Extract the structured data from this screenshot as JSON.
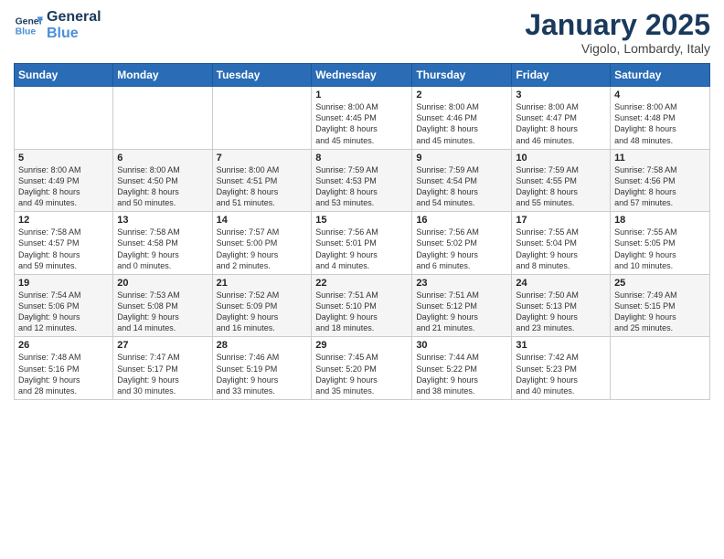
{
  "logo": {
    "line1": "General",
    "line2": "Blue"
  },
  "title": "January 2025",
  "location": "Vigolo, Lombardy, Italy",
  "days_header": [
    "Sunday",
    "Monday",
    "Tuesday",
    "Wednesday",
    "Thursday",
    "Friday",
    "Saturday"
  ],
  "weeks": [
    [
      {
        "num": "",
        "info": ""
      },
      {
        "num": "",
        "info": ""
      },
      {
        "num": "",
        "info": ""
      },
      {
        "num": "1",
        "info": "Sunrise: 8:00 AM\nSunset: 4:45 PM\nDaylight: 8 hours\nand 45 minutes."
      },
      {
        "num": "2",
        "info": "Sunrise: 8:00 AM\nSunset: 4:46 PM\nDaylight: 8 hours\nand 45 minutes."
      },
      {
        "num": "3",
        "info": "Sunrise: 8:00 AM\nSunset: 4:47 PM\nDaylight: 8 hours\nand 46 minutes."
      },
      {
        "num": "4",
        "info": "Sunrise: 8:00 AM\nSunset: 4:48 PM\nDaylight: 8 hours\nand 48 minutes."
      }
    ],
    [
      {
        "num": "5",
        "info": "Sunrise: 8:00 AM\nSunset: 4:49 PM\nDaylight: 8 hours\nand 49 minutes."
      },
      {
        "num": "6",
        "info": "Sunrise: 8:00 AM\nSunset: 4:50 PM\nDaylight: 8 hours\nand 50 minutes."
      },
      {
        "num": "7",
        "info": "Sunrise: 8:00 AM\nSunset: 4:51 PM\nDaylight: 8 hours\nand 51 minutes."
      },
      {
        "num": "8",
        "info": "Sunrise: 7:59 AM\nSunset: 4:53 PM\nDaylight: 8 hours\nand 53 minutes."
      },
      {
        "num": "9",
        "info": "Sunrise: 7:59 AM\nSunset: 4:54 PM\nDaylight: 8 hours\nand 54 minutes."
      },
      {
        "num": "10",
        "info": "Sunrise: 7:59 AM\nSunset: 4:55 PM\nDaylight: 8 hours\nand 55 minutes."
      },
      {
        "num": "11",
        "info": "Sunrise: 7:58 AM\nSunset: 4:56 PM\nDaylight: 8 hours\nand 57 minutes."
      }
    ],
    [
      {
        "num": "12",
        "info": "Sunrise: 7:58 AM\nSunset: 4:57 PM\nDaylight: 8 hours\nand 59 minutes."
      },
      {
        "num": "13",
        "info": "Sunrise: 7:58 AM\nSunset: 4:58 PM\nDaylight: 9 hours\nand 0 minutes."
      },
      {
        "num": "14",
        "info": "Sunrise: 7:57 AM\nSunset: 5:00 PM\nDaylight: 9 hours\nand 2 minutes."
      },
      {
        "num": "15",
        "info": "Sunrise: 7:56 AM\nSunset: 5:01 PM\nDaylight: 9 hours\nand 4 minutes."
      },
      {
        "num": "16",
        "info": "Sunrise: 7:56 AM\nSunset: 5:02 PM\nDaylight: 9 hours\nand 6 minutes."
      },
      {
        "num": "17",
        "info": "Sunrise: 7:55 AM\nSunset: 5:04 PM\nDaylight: 9 hours\nand 8 minutes."
      },
      {
        "num": "18",
        "info": "Sunrise: 7:55 AM\nSunset: 5:05 PM\nDaylight: 9 hours\nand 10 minutes."
      }
    ],
    [
      {
        "num": "19",
        "info": "Sunrise: 7:54 AM\nSunset: 5:06 PM\nDaylight: 9 hours\nand 12 minutes."
      },
      {
        "num": "20",
        "info": "Sunrise: 7:53 AM\nSunset: 5:08 PM\nDaylight: 9 hours\nand 14 minutes."
      },
      {
        "num": "21",
        "info": "Sunrise: 7:52 AM\nSunset: 5:09 PM\nDaylight: 9 hours\nand 16 minutes."
      },
      {
        "num": "22",
        "info": "Sunrise: 7:51 AM\nSunset: 5:10 PM\nDaylight: 9 hours\nand 18 minutes."
      },
      {
        "num": "23",
        "info": "Sunrise: 7:51 AM\nSunset: 5:12 PM\nDaylight: 9 hours\nand 21 minutes."
      },
      {
        "num": "24",
        "info": "Sunrise: 7:50 AM\nSunset: 5:13 PM\nDaylight: 9 hours\nand 23 minutes."
      },
      {
        "num": "25",
        "info": "Sunrise: 7:49 AM\nSunset: 5:15 PM\nDaylight: 9 hours\nand 25 minutes."
      }
    ],
    [
      {
        "num": "26",
        "info": "Sunrise: 7:48 AM\nSunset: 5:16 PM\nDaylight: 9 hours\nand 28 minutes."
      },
      {
        "num": "27",
        "info": "Sunrise: 7:47 AM\nSunset: 5:17 PM\nDaylight: 9 hours\nand 30 minutes."
      },
      {
        "num": "28",
        "info": "Sunrise: 7:46 AM\nSunset: 5:19 PM\nDaylight: 9 hours\nand 33 minutes."
      },
      {
        "num": "29",
        "info": "Sunrise: 7:45 AM\nSunset: 5:20 PM\nDaylight: 9 hours\nand 35 minutes."
      },
      {
        "num": "30",
        "info": "Sunrise: 7:44 AM\nSunset: 5:22 PM\nDaylight: 9 hours\nand 38 minutes."
      },
      {
        "num": "31",
        "info": "Sunrise: 7:42 AM\nSunset: 5:23 PM\nDaylight: 9 hours\nand 40 minutes."
      },
      {
        "num": "",
        "info": ""
      }
    ]
  ]
}
